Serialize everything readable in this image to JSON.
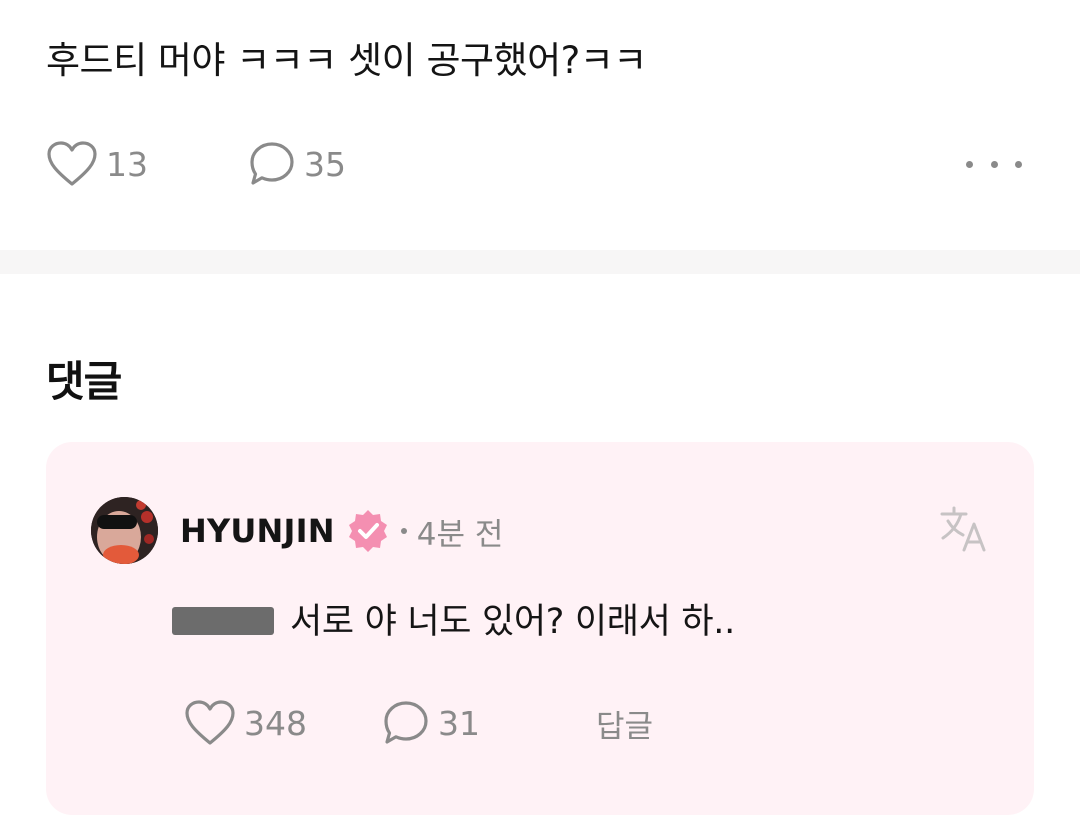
{
  "post": {
    "text": "후드티 머야 ㅋㅋㅋ 셋이 공구했어?ㅋㅋ",
    "like_count": "13",
    "comment_count": "35"
  },
  "comments_section": {
    "title": "댓글"
  },
  "comment": {
    "username": "HYUNJIN",
    "verified_badge_icon": "verified-badge-icon",
    "badge_color": "#f48fb1",
    "timestamp": "4분 전",
    "text": "서로 야 너도 있어? 이래서 하..",
    "like_count": "348",
    "reply_count": "31",
    "reply_label": "답글",
    "card_color": "#fff2f6"
  },
  "icons": {
    "like": "heart-outline-icon",
    "comment": "speech-bubble-icon",
    "more": "more-horizontal-icon",
    "translate": "translate-icon"
  }
}
